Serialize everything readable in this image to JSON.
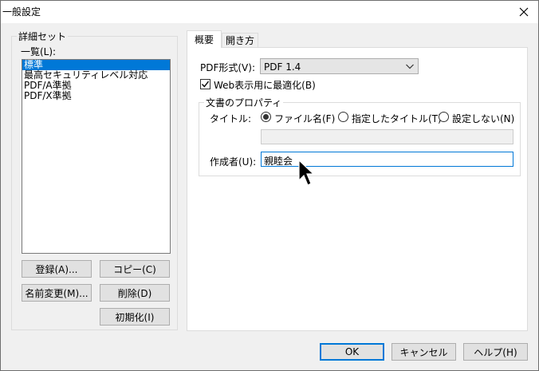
{
  "window": {
    "title": "一般設定"
  },
  "left": {
    "group_label": "詳細セット",
    "list_label": "一覧(L):",
    "items": [
      "標準",
      "最高セキュリティレベル対応",
      "PDF/A準拠",
      "PDF/X準拠"
    ],
    "buttons": {
      "register": "登録(A)...",
      "copy": "コピー(C)",
      "rename": "名前変更(M)...",
      "delete": "削除(D)",
      "reset": "初期化(I)"
    }
  },
  "tabs": [
    {
      "label": "概要",
      "active": true
    },
    {
      "label": "開き方",
      "active": false
    }
  ],
  "overview": {
    "pdf_format_label": "PDF形式(V):",
    "pdf_format_value": "PDF 1.4",
    "web_optimize_label": "Web表示用に最適化(B)",
    "web_optimize_checked": true,
    "doc_props_label": "文書のプロパティ",
    "title_label": "タイトル:",
    "title_options": [
      {
        "label": "ファイル名(F)",
        "selected": true
      },
      {
        "label": "指定したタイトル(T)",
        "selected": false
      },
      {
        "label": "設定しない(N)",
        "selected": false
      }
    ],
    "title_text_value": "",
    "author_label": "作成者(U):",
    "author_value": "親睦会"
  },
  "footer": {
    "ok": "OK",
    "cancel": "キャンセル",
    "help": "ヘルプ(H)"
  },
  "colors": {
    "selection": "#0078d7",
    "dialog_bg": "#f0f0f0",
    "focus_border": "#0078d7"
  }
}
